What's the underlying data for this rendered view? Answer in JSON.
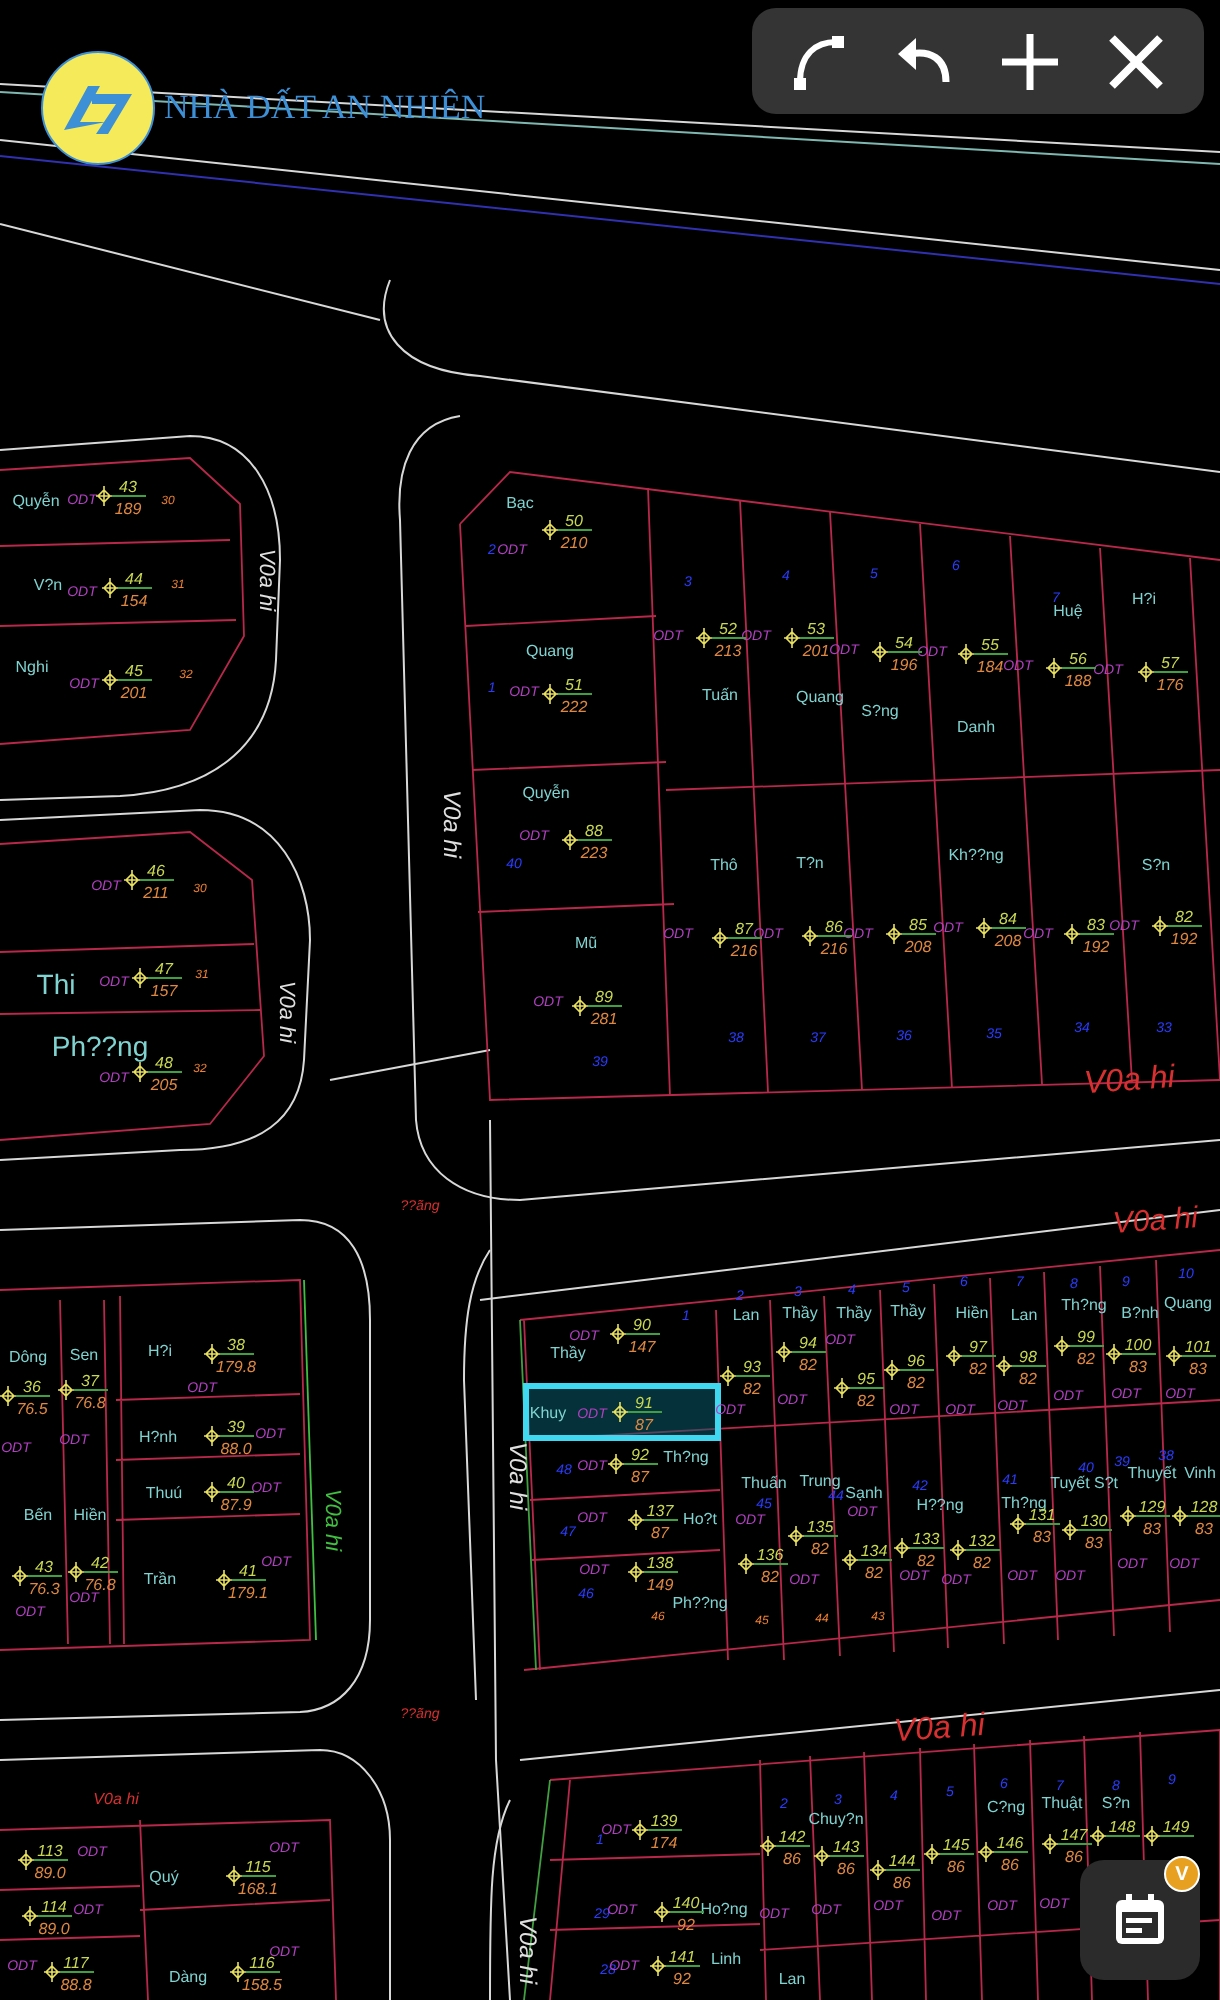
{
  "logo": {
    "text": "NHÀ ĐẤT AN NHIÊN"
  },
  "toolbar": {
    "buttons": [
      {
        "kind": "arc"
      },
      {
        "kind": "undo"
      },
      {
        "kind": "add"
      },
      {
        "kind": "close"
      }
    ]
  },
  "schedule_button": {
    "badge": "V"
  },
  "map": {
    "streets": [
      {
        "kind": "road",
        "text": "V0a hi"
      },
      {
        "kind": "road",
        "text": "V0a hi"
      },
      {
        "kind": "road",
        "text": "V0a hi"
      },
      {
        "kind": "road_label",
        "text": "V0a hi"
      },
      {
        "kind": "road_label",
        "text": "V0a hi"
      },
      {
        "kind": "road",
        "text": "V0a hi"
      },
      {
        "kind": "edge",
        "text": "V0a hi"
      },
      {
        "kind": "road_label",
        "text": "??ãng"
      },
      {
        "kind": "road_label",
        "text": "??ãng"
      },
      {
        "kind": "road_label",
        "text": "V0a hi"
      },
      {
        "kind": "road_label",
        "text": "V0a hi"
      },
      {
        "kind": "road",
        "text": "V0a hi"
      }
    ],
    "labels": [
      {
        "kind": "owner",
        "text": "Quyễn"
      },
      {
        "kind": "use",
        "text": "ODT"
      },
      {
        "kind": "parcel",
        "text": "30"
      },
      {
        "kind": "owner",
        "text": "V?n"
      },
      {
        "kind": "use",
        "text": "ODT"
      },
      {
        "kind": "parcel",
        "text": "31"
      },
      {
        "kind": "owner",
        "text": "Nghi"
      },
      {
        "kind": "use",
        "text": "ODT"
      },
      {
        "kind": "parcel",
        "text": "32"
      },
      {
        "kind": "use",
        "text": "ODT"
      },
      {
        "kind": "parcel",
        "text": "30"
      },
      {
        "kind": "owner",
        "text": "Thi"
      },
      {
        "kind": "use",
        "text": "ODT"
      },
      {
        "kind": "parcel",
        "text": "31"
      },
      {
        "kind": "owner",
        "text": "Ph??ng"
      },
      {
        "kind": "use",
        "text": "ODT"
      },
      {
        "kind": "parcel",
        "text": "32"
      },
      {
        "kind": "owner",
        "text": "Bạc"
      },
      {
        "kind": "index",
        "text": "2"
      },
      {
        "kind": "use",
        "text": "ODT"
      },
      {
        "kind": "owner",
        "text": "Quang"
      },
      {
        "kind": "index",
        "text": "1"
      },
      {
        "kind": "use",
        "text": "ODT"
      },
      {
        "kind": "index",
        "text": "3"
      },
      {
        "kind": "index",
        "text": "4"
      },
      {
        "kind": "index",
        "text": "5"
      },
      {
        "kind": "index",
        "text": "6"
      },
      {
        "kind": "index",
        "text": "7"
      },
      {
        "kind": "owner",
        "text": "Huệ"
      },
      {
        "kind": "owner",
        "text": "H?i"
      },
      {
        "kind": "use",
        "text": "ODT"
      },
      {
        "kind": "use",
        "text": "ODT"
      },
      {
        "kind": "use",
        "text": "ODT"
      },
      {
        "kind": "use",
        "text": "ODT"
      },
      {
        "kind": "use",
        "text": "ODT"
      },
      {
        "kind": "use",
        "text": "ODT"
      },
      {
        "kind": "owner",
        "text": "Tuấn"
      },
      {
        "kind": "owner",
        "text": "Quang"
      },
      {
        "kind": "owner",
        "text": "S?ng"
      },
      {
        "kind": "owner",
        "text": "Danh"
      },
      {
        "kind": "owner",
        "text": "Quyễn"
      },
      {
        "kind": "use",
        "text": "ODT"
      },
      {
        "kind": "index",
        "text": "40"
      },
      {
        "kind": "owner",
        "text": "Thô"
      },
      {
        "kind": "owner",
        "text": "T?n"
      },
      {
        "kind": "owner",
        "text": "Kh??ng"
      },
      {
        "kind": "owner",
        "text": "S?n"
      },
      {
        "kind": "use",
        "text": "ODT"
      },
      {
        "kind": "use",
        "text": "ODT"
      },
      {
        "kind": "use",
        "text": "ODT"
      },
      {
        "kind": "use",
        "text": "ODT"
      },
      {
        "kind": "use",
        "text": "ODT"
      },
      {
        "kind": "use",
        "text": "ODT"
      },
      {
        "kind": "owner",
        "text": "Mũ"
      },
      {
        "kind": "use",
        "text": "ODT"
      },
      {
        "kind": "index",
        "text": "39"
      },
      {
        "kind": "index",
        "text": "38"
      },
      {
        "kind": "index",
        "text": "37"
      },
      {
        "kind": "index",
        "text": "36"
      },
      {
        "kind": "index",
        "text": "35"
      },
      {
        "kind": "index",
        "text": "34"
      },
      {
        "kind": "index",
        "text": "33"
      },
      {
        "kind": "index",
        "text": "1"
      },
      {
        "kind": "owner",
        "text": "Thầy"
      },
      {
        "kind": "use",
        "text": "ODT"
      },
      {
        "kind": "index",
        "text": "2"
      },
      {
        "kind": "owner",
        "text": "Lan"
      },
      {
        "kind": "index",
        "text": "3"
      },
      {
        "kind": "owner",
        "text": "Thầy"
      },
      {
        "kind": "index",
        "text": "4"
      },
      {
        "kind": "owner",
        "text": "Thầy"
      },
      {
        "kind": "index",
        "text": "5"
      },
      {
        "kind": "owner",
        "text": "Thầy"
      },
      {
        "kind": "index",
        "text": "6"
      },
      {
        "kind": "owner",
        "text": "Hiền"
      },
      {
        "kind": "index",
        "text": "7"
      },
      {
        "kind": "owner",
        "text": "Lan"
      },
      {
        "kind": "index",
        "text": "8"
      },
      {
        "kind": "owner",
        "text": "Th?ng"
      },
      {
        "kind": "index",
        "text": "9"
      },
      {
        "kind": "owner",
        "text": "B?nh"
      },
      {
        "kind": "index",
        "text": "10"
      },
      {
        "kind": "owner",
        "text": "Quang"
      },
      {
        "kind": "use",
        "text": "ODT"
      },
      {
        "kind": "use",
        "text": "ODT"
      },
      {
        "kind": "use",
        "text": "ODT"
      },
      {
        "kind": "use",
        "text": "ODT"
      },
      {
        "kind": "use",
        "text": "ODT"
      },
      {
        "kind": "use",
        "text": "ODT"
      },
      {
        "kind": "use",
        "text": "ODT"
      },
      {
        "kind": "use",
        "text": "ODT"
      },
      {
        "kind": "use",
        "text": "ODT"
      },
      {
        "kind": "owner",
        "text": "Khuy"
      },
      {
        "kind": "use",
        "text": "ODT"
      },
      {
        "kind": "index",
        "text": "48"
      },
      {
        "kind": "use",
        "text": "ODT"
      },
      {
        "kind": "owner",
        "text": "Th?ng"
      },
      {
        "kind": "owner",
        "text": "Thuấn"
      },
      {
        "kind": "owner",
        "text": "Trung"
      },
      {
        "kind": "owner",
        "text": "Sạnh"
      },
      {
        "kind": "owner",
        "text": "H??ng"
      },
      {
        "kind": "owner",
        "text": "Th?ng"
      },
      {
        "kind": "owner",
        "text": "Tuyết"
      },
      {
        "kind": "owner",
        "text": "S?t"
      },
      {
        "kind": "owner",
        "text": "Thuyết"
      },
      {
        "kind": "owner",
        "text": "Vinh"
      },
      {
        "kind": "index",
        "text": "45"
      },
      {
        "kind": "index",
        "text": "44"
      },
      {
        "kind": "index",
        "text": "42"
      },
      {
        "kind": "index",
        "text": "41"
      },
      {
        "kind": "index",
        "text": "40"
      },
      {
        "kind": "index",
        "text": "39"
      },
      {
        "kind": "index",
        "text": "38"
      },
      {
        "kind": "index",
        "text": "47"
      },
      {
        "kind": "use",
        "text": "ODT"
      },
      {
        "kind": "owner",
        "text": "Ho?t"
      },
      {
        "kind": "use",
        "text": "ODT"
      },
      {
        "kind": "use",
        "text": "ODT"
      },
      {
        "kind": "use",
        "text": "ODT"
      },
      {
        "kind": "use",
        "text": "ODT"
      },
      {
        "kind": "use",
        "text": "ODT"
      },
      {
        "kind": "use",
        "text": "ODT"
      },
      {
        "kind": "use",
        "text": "ODT"
      },
      {
        "kind": "use",
        "text": "ODT"
      },
      {
        "kind": "use",
        "text": "ODT"
      },
      {
        "kind": "use",
        "text": "ODT"
      },
      {
        "kind": "index",
        "text": "46"
      },
      {
        "kind": "owner",
        "text": "Ph??ng"
      },
      {
        "kind": "parcel",
        "text": "46"
      },
      {
        "kind": "parcel",
        "text": "45"
      },
      {
        "kind": "parcel",
        "text": "44"
      },
      {
        "kind": "parcel",
        "text": "43"
      },
      {
        "kind": "owner",
        "text": "Dông"
      },
      {
        "kind": "owner",
        "text": "Sen"
      },
      {
        "kind": "owner",
        "text": "H?i"
      },
      {
        "kind": "use",
        "text": "ODT"
      },
      {
        "kind": "use",
        "text": "ODT"
      },
      {
        "kind": "use",
        "text": "ODT"
      },
      {
        "kind": "owner",
        "text": "H?nh"
      },
      {
        "kind": "use",
        "text": "ODT"
      },
      {
        "kind": "owner",
        "text": "Thuú"
      },
      {
        "kind": "use",
        "text": "ODT"
      },
      {
        "kind": "owner",
        "text": "Bến"
      },
      {
        "kind": "owner",
        "text": "Hiền"
      },
      {
        "kind": "use",
        "text": "ODT"
      },
      {
        "kind": "use",
        "text": "ODT"
      },
      {
        "kind": "owner",
        "text": "Trần"
      },
      {
        "kind": "use",
        "text": "ODT"
      },
      {
        "kind": "use",
        "text": "ODT"
      },
      {
        "kind": "owner",
        "text": "Quý"
      },
      {
        "kind": "use",
        "text": "ODT"
      },
      {
        "kind": "use",
        "text": "ODT"
      },
      {
        "kind": "use",
        "text": "ODT"
      },
      {
        "kind": "owner",
        "text": "Dàng"
      },
      {
        "kind": "use",
        "text": "ODT"
      },
      {
        "kind": "index",
        "text": "1"
      },
      {
        "kind": "use",
        "text": "ODT"
      },
      {
        "kind": "index",
        "text": "2"
      },
      {
        "kind": "index",
        "text": "3"
      },
      {
        "kind": "index",
        "text": "4"
      },
      {
        "kind": "index",
        "text": "5"
      },
      {
        "kind": "index",
        "text": "6"
      },
      {
        "kind": "index",
        "text": "7"
      },
      {
        "kind": "index",
        "text": "8"
      },
      {
        "kind": "index",
        "text": "9"
      },
      {
        "kind": "owner",
        "text": "Chuy?n"
      },
      {
        "kind": "owner",
        "text": "C?ng"
      },
      {
        "kind": "owner",
        "text": "Thuật"
      },
      {
        "kind": "owner",
        "text": "S?n"
      },
      {
        "kind": "use",
        "text": "ODT"
      },
      {
        "kind": "use",
        "text": "ODT"
      },
      {
        "kind": "use",
        "text": "ODT"
      },
      {
        "kind": "use",
        "text": "ODT"
      },
      {
        "kind": "use",
        "text": "ODT"
      },
      {
        "kind": "use",
        "text": "ODT"
      },
      {
        "kind": "index",
        "text": "29"
      },
      {
        "kind": "use",
        "text": "ODT"
      },
      {
        "kind": "owner",
        "text": "Ho?ng"
      },
      {
        "kind": "index",
        "text": "28"
      },
      {
        "kind": "use",
        "text": "ODT"
      },
      {
        "kind": "owner",
        "text": "Linh"
      },
      {
        "kind": "owner",
        "text": "Lan"
      }
    ],
    "lots": [
      {
        "number": "43",
        "area": "189",
        "selected": false
      },
      {
        "number": "44",
        "area": "154",
        "selected": false
      },
      {
        "number": "45",
        "area": "201",
        "selected": false
      },
      {
        "number": "46",
        "area": "211",
        "selected": false
      },
      {
        "number": "47",
        "area": "157",
        "selected": false
      },
      {
        "number": "48",
        "area": "205",
        "selected": false
      },
      {
        "number": "50",
        "area": "210",
        "selected": false
      },
      {
        "number": "51",
        "area": "222",
        "selected": false
      },
      {
        "number": "52",
        "area": "213",
        "selected": false
      },
      {
        "number": "53",
        "area": "201",
        "selected": false
      },
      {
        "number": "54",
        "area": "196",
        "selected": false
      },
      {
        "number": "55",
        "area": "184",
        "selected": false
      },
      {
        "number": "56",
        "area": "188",
        "selected": false
      },
      {
        "number": "57",
        "area": "176",
        "selected": false
      },
      {
        "number": "88",
        "area": "223",
        "selected": false
      },
      {
        "number": "87",
        "area": "216",
        "selected": false
      },
      {
        "number": "86",
        "area": "216",
        "selected": false
      },
      {
        "number": "85",
        "area": "208",
        "selected": false
      },
      {
        "number": "84",
        "area": "208",
        "selected": false
      },
      {
        "number": "83",
        "area": "192",
        "selected": false
      },
      {
        "number": "82",
        "area": "192",
        "selected": false
      },
      {
        "number": "89",
        "area": "281",
        "selected": false
      },
      {
        "number": "90",
        "area": "147",
        "selected": false
      },
      {
        "number": "93",
        "area": "82",
        "selected": false
      },
      {
        "number": "94",
        "area": "82",
        "selected": false
      },
      {
        "number": "95",
        "area": "82",
        "selected": false
      },
      {
        "number": "96",
        "area": "82",
        "selected": false
      },
      {
        "number": "97",
        "area": "82",
        "selected": false
      },
      {
        "number": "98",
        "area": "82",
        "selected": false
      },
      {
        "number": "99",
        "area": "82",
        "selected": false
      },
      {
        "number": "100",
        "area": "83",
        "selected": false
      },
      {
        "number": "101",
        "area": "83",
        "selected": false
      },
      {
        "number": "91",
        "area": "87",
        "selected": true
      },
      {
        "number": "92",
        "area": "87",
        "selected": false
      },
      {
        "number": "137",
        "area": "87",
        "selected": false
      },
      {
        "number": "138",
        "area": "149",
        "selected": false
      },
      {
        "number": "136",
        "area": "82",
        "selected": false
      },
      {
        "number": "135",
        "area": "82",
        "selected": false
      },
      {
        "number": "134",
        "area": "82",
        "selected": false
      },
      {
        "number": "133",
        "area": "82",
        "selected": false
      },
      {
        "number": "132",
        "area": "82",
        "selected": false
      },
      {
        "number": "131",
        "area": "83",
        "selected": false
      },
      {
        "number": "130",
        "area": "83",
        "selected": false
      },
      {
        "number": "129",
        "area": "83",
        "selected": false
      },
      {
        "number": "128",
        "area": "83",
        "selected": false
      },
      {
        "number": "38",
        "area": "179.8",
        "selected": false
      },
      {
        "number": "36",
        "area": "76.5",
        "selected": false
      },
      {
        "number": "37",
        "area": "76.8",
        "selected": false
      },
      {
        "number": "39",
        "area": "88.0",
        "selected": false
      },
      {
        "number": "40",
        "area": "87.9",
        "selected": false
      },
      {
        "number": "43",
        "area": "76.3",
        "selected": false
      },
      {
        "number": "42",
        "area": "76.8",
        "selected": false
      },
      {
        "number": "41",
        "area": "179.1",
        "selected": false
      },
      {
        "number": "113",
        "area": "89.0",
        "selected": false
      },
      {
        "number": "115",
        "area": "168.1",
        "selected": false
      },
      {
        "number": "114",
        "area": "89.0",
        "selected": false
      },
      {
        "number": "117",
        "area": "88.8",
        "selected": false
      },
      {
        "number": "116",
        "area": "158.5",
        "selected": false
      },
      {
        "number": "139",
        "area": "174",
        "selected": false
      },
      {
        "number": "142",
        "area": "86",
        "selected": false
      },
      {
        "number": "143",
        "area": "86",
        "selected": false
      },
      {
        "number": "144",
        "area": "86",
        "selected": false
      },
      {
        "number": "145",
        "area": "86",
        "selected": false
      },
      {
        "number": "146",
        "area": "86",
        "selected": false
      },
      {
        "number": "147",
        "area": "86",
        "selected": false
      },
      {
        "number": "148",
        "selected": false
      },
      {
        "number": "149",
        "selected": false
      },
      {
        "number": "140",
        "area": "92",
        "selected": false
      },
      {
        "number": "141",
        "area": "92",
        "selected": false
      }
    ]
  }
}
